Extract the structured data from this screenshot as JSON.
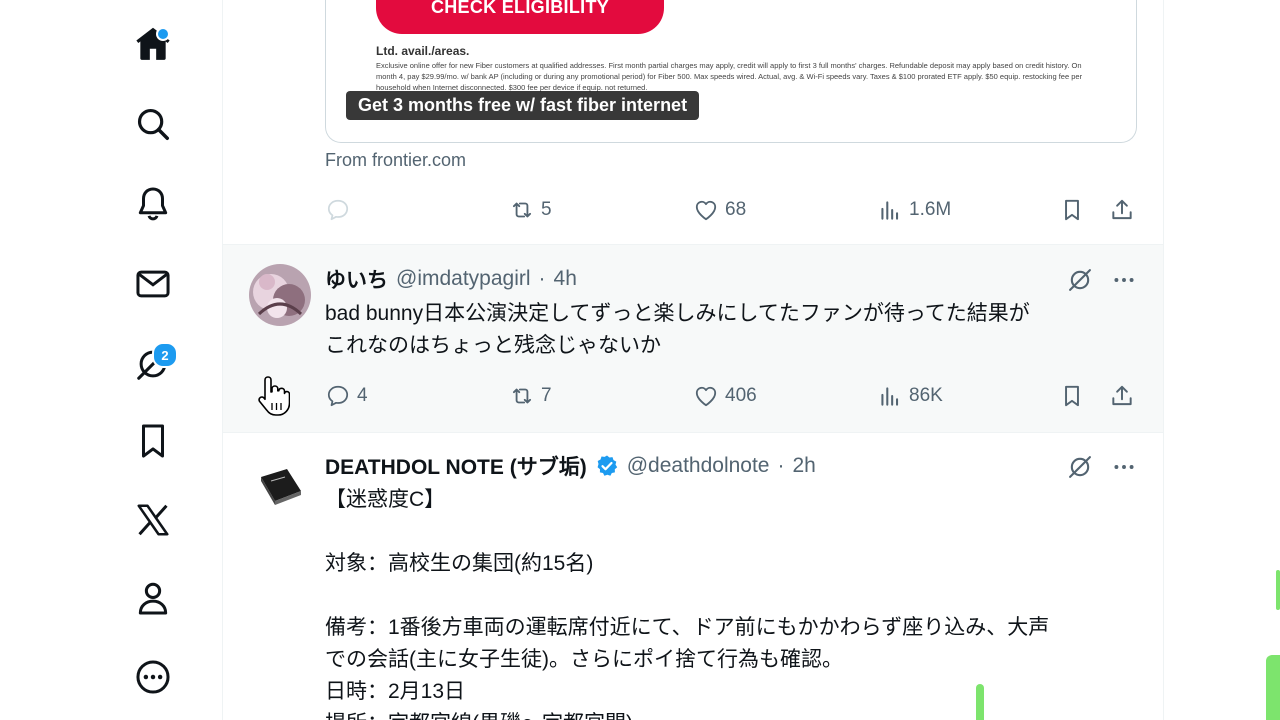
{
  "nav": {
    "items": [
      {
        "name": "home",
        "icon": "home-icon",
        "has_dot": true
      },
      {
        "name": "explore",
        "icon": "search-icon"
      },
      {
        "name": "notifications",
        "icon": "bell-icon"
      },
      {
        "name": "messages",
        "icon": "envelope-icon"
      },
      {
        "name": "grok",
        "icon": "grok-icon",
        "badge": "2"
      },
      {
        "name": "bookmarks",
        "icon": "bookmark-icon"
      },
      {
        "name": "premium",
        "icon": "x-logo-icon"
      },
      {
        "name": "profile",
        "icon": "person-icon"
      },
      {
        "name": "more",
        "icon": "more-circle-icon"
      }
    ],
    "accent": "#1d9bf0"
  },
  "ad": {
    "cta": "CHECK ELIGIBILITY",
    "heading": "Ltd. avail./areas.",
    "fine_print": "Exclusive online offer for new Fiber customers at qualified addresses. First month partial charges may apply, credit will apply to first 3 full months' charges. Refundable deposit may apply based on credit history. On month 4, pay $29.99/mo. w/ bank AP (including or during any promotional period) for Fiber 500. Max speeds wired. Actual, avg. & Wi-Fi speeds vary. Taxes & $100 prorated ETF apply. $50 equip. restocking fee per household when Internet disconnected. $300 fee per device if equip. not returned.",
    "headline": "Get 3 months free w/ fast fiber internet",
    "source": "From frontier.com",
    "brand_color": "#e30b3e",
    "stats": {
      "replies": "",
      "reposts": "5",
      "likes": "68",
      "views": "1.6M"
    }
  },
  "tweets": [
    {
      "name": "ゆいち",
      "handle": "@imdatypagirl",
      "time": "4h",
      "text": "bad bunny日本公演決定してずっと楽しみにしてたファンが待ってた結果が\nこれなのはちょっと残念じゃないか",
      "stats": {
        "replies": "4",
        "reposts": "7",
        "likes": "406",
        "views": "86K"
      }
    },
    {
      "name": "DEATHDOL NOTE (サブ垢)",
      "handle": "@deathdolnote",
      "time": "2h",
      "verified": true,
      "text": "【迷惑度C】\n\n対象：高校生の集団(約15名)\n\n備考：1番後方車両の運転席付近にて、ドア前にもかかわらず座り込み、大声\nでの会話(主に女子生徒)。さらにポイ捨て行為も確認。\n日時：2月13日\n場所：宇都宮線(黒磯〜宇都宮間)"
    }
  ],
  "separator": "·"
}
